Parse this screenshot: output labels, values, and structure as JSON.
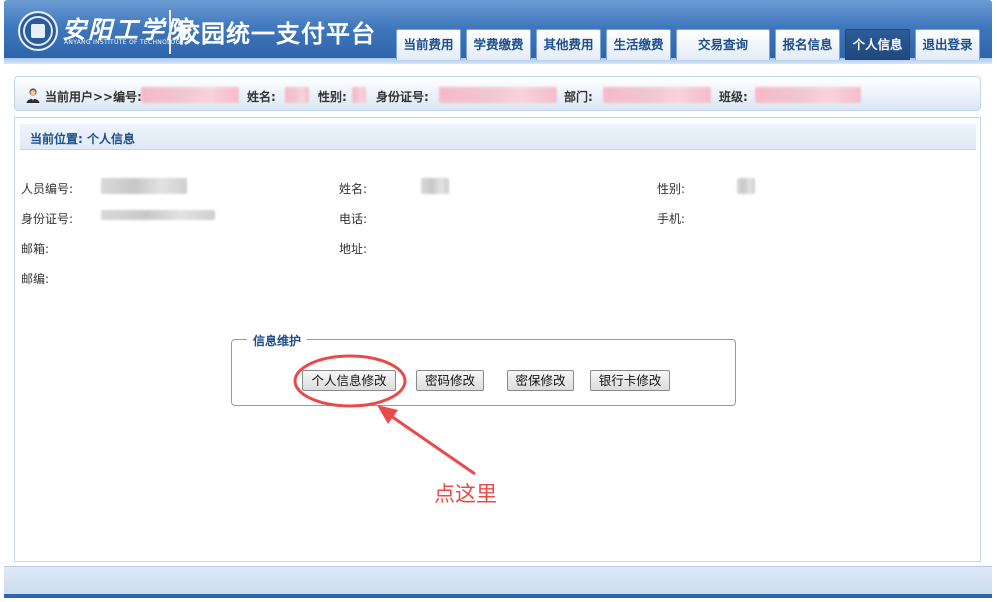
{
  "header": {
    "school_name": "安阳工学院",
    "school_name_en": "ANYANG INSTITUTE OF TECHNOLOGY",
    "app_title": "校园统一支付平台"
  },
  "nav": {
    "tabs": [
      {
        "label": "当前费用"
      },
      {
        "label": "学费缴费"
      },
      {
        "label": "其他费用"
      },
      {
        "label": "生活缴费"
      },
      {
        "label": "交易查询"
      },
      {
        "label": "报名信息"
      },
      {
        "label": "个人信息",
        "active": true
      },
      {
        "label": "退出登录"
      }
    ]
  },
  "user_bar": {
    "prefix": "当前用户>>编号:",
    "name_label": "姓名:",
    "gender_label": "性别:",
    "id_label": "身份证号:",
    "dept_label": "部门:",
    "class_label": "班级:"
  },
  "breadcrumb": "当前位置: 个人信息",
  "profile": {
    "person_no_label": "人员编号:",
    "name_label": "姓名:",
    "gender_label": "性别:",
    "id_no_label": "身份证号:",
    "phone_label": "电话:",
    "mobile_label": "手机:",
    "email_label": "邮箱:",
    "address_label": "地址:",
    "postcode_label": "邮编:"
  },
  "maintenance": {
    "legend": "信息维护",
    "buttons": {
      "edit_profile": "个人信息修改",
      "change_password": "密码修改",
      "security_question": "密保修改",
      "bank_card": "银行卡修改"
    }
  },
  "annotation": {
    "text": "点这里",
    "color": "#e94b4b"
  },
  "colors": {
    "header_blue": "#3f77bd",
    "nav_active": "#1f477b",
    "label_blue": "#1d4f8c"
  }
}
